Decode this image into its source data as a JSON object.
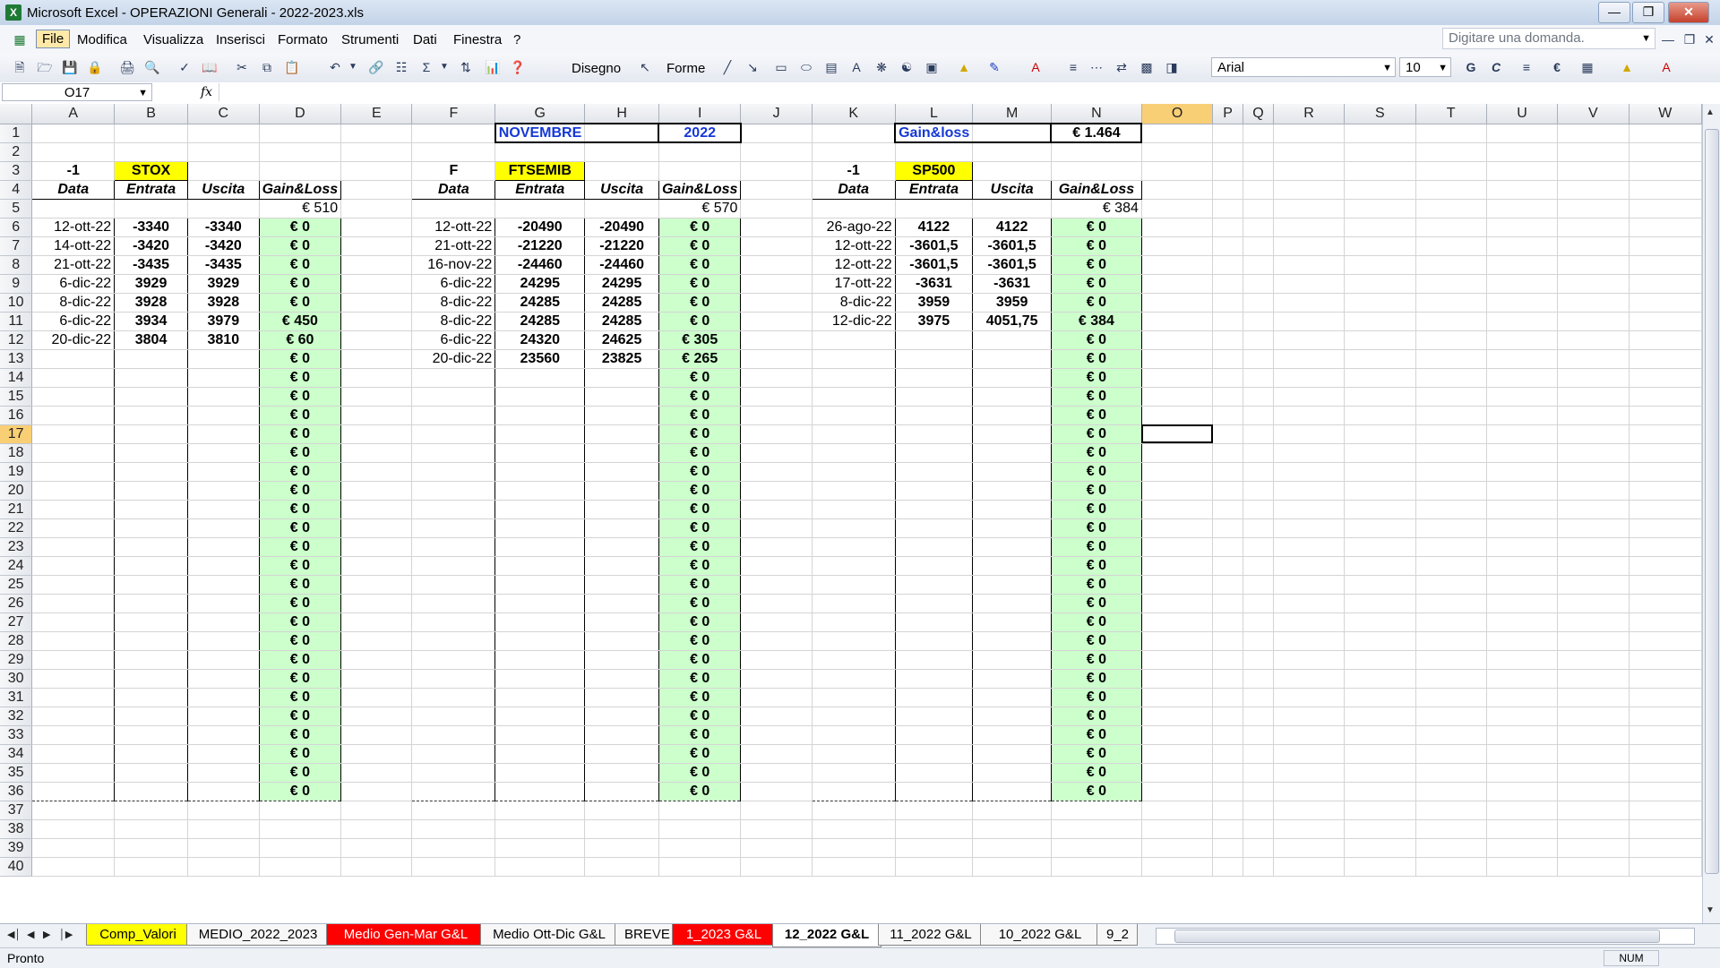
{
  "window": {
    "title": "Microsoft Excel - OPERAZIONI Generali - 2022-2023.xls"
  },
  "menu": [
    "File",
    "Modifica",
    "Visualizza",
    "Inserisci",
    "Formato",
    "Strumenti",
    "Dati",
    "Finestra",
    "?"
  ],
  "ask_placeholder": "Digitare una domanda.",
  "toolbar": {
    "draw_label": "Disegno",
    "shapes_label": "Forme",
    "font": "Arial",
    "size": "10",
    "bold_label": "G",
    "italic_label": "C"
  },
  "namebox": "O17",
  "fx": "fx",
  "columns": [
    "A",
    "B",
    "C",
    "D",
    "E",
    "F",
    "G",
    "H",
    "I",
    "J",
    "K",
    "L",
    "M",
    "N",
    "O",
    "P",
    "Q",
    "R",
    "S",
    "T",
    "U",
    "V",
    "W"
  ],
  "header_row1": {
    "month": "NOVEMBRE",
    "year": "2022",
    "gl_label": "Gain&loss",
    "gl_total": "€ 1.464"
  },
  "row3": {
    "stox_sign": "-1",
    "stox": "STOX",
    "ftse_sign": "F",
    "ftse": "FTSEMIB",
    "sp_sign": "-1",
    "sp": "SP500"
  },
  "row4": {
    "data": "Data",
    "entrata": "Entrata",
    "uscita": "Uscita",
    "gl": "Gain&Loss"
  },
  "row5": {
    "stox_total": "€ 510",
    "ftse_total": "€ 570",
    "sp_total": "€ 384"
  },
  "stox_rows": [
    [
      "12-ott-22",
      "-3340",
      "-3340",
      "€ 0"
    ],
    [
      "14-ott-22",
      "-3420",
      "-3420",
      "€ 0"
    ],
    [
      "21-ott-22",
      "-3435",
      "-3435",
      "€ 0"
    ],
    [
      "6-dic-22",
      "3929",
      "3929",
      "€ 0"
    ],
    [
      "8-dic-22",
      "3928",
      "3928",
      "€ 0"
    ],
    [
      "6-dic-22",
      "3934",
      "3979",
      "€ 450"
    ],
    [
      "20-dic-22",
      "3804",
      "3810",
      "€ 60"
    ]
  ],
  "ftse_rows": [
    [
      "12-ott-22",
      "-20490",
      "-20490",
      "€ 0"
    ],
    [
      "21-ott-22",
      "-21220",
      "-21220",
      "€ 0"
    ],
    [
      "16-nov-22",
      "-24460",
      "-24460",
      "€ 0"
    ],
    [
      "6-dic-22",
      "24295",
      "24295",
      "€ 0"
    ],
    [
      "8-dic-22",
      "24285",
      "24285",
      "€ 0"
    ],
    [
      "8-dic-22",
      "24285",
      "24285",
      "€ 0"
    ],
    [
      "6-dic-22",
      "24320",
      "24625",
      "€ 305"
    ],
    [
      "20-dic-22",
      "23560",
      "23825",
      "€ 265"
    ]
  ],
  "sp_rows": [
    [
      "26-ago-22",
      "4122",
      "4122",
      "€ 0"
    ],
    [
      "12-ott-22",
      "-3601,5",
      "-3601,5",
      "€ 0"
    ],
    [
      "12-ott-22",
      "-3601,5",
      "-3601,5",
      "€ 0"
    ],
    [
      "17-ott-22",
      "-3631",
      "-3631",
      "€ 0"
    ],
    [
      "8-dic-22",
      "3959",
      "3959",
      "€ 0"
    ],
    [
      "12-dic-22",
      "3975",
      "4051,75",
      "€ 384"
    ]
  ],
  "empty_gl": "€ 0",
  "tabs": [
    {
      "label": "Comp_Valori",
      "style": "yellow"
    },
    {
      "label": "MEDIO_2022_2023",
      "style": ""
    },
    {
      "label": "Medio Gen-Mar G&L",
      "style": "red"
    },
    {
      "label": "Medio Ott-Dic G&L",
      "style": ""
    },
    {
      "label": "BREVE",
      "style": ""
    },
    {
      "label": "1_2023 G&L",
      "style": "red"
    },
    {
      "label": "12_2022 G&L",
      "style": "current"
    },
    {
      "label": "11_2022 G&L",
      "style": ""
    },
    {
      "label": "10_2022 G&L",
      "style": ""
    },
    {
      "label": "9_2",
      "style": ""
    }
  ],
  "status": {
    "text": "Pronto",
    "num": "NUM"
  }
}
